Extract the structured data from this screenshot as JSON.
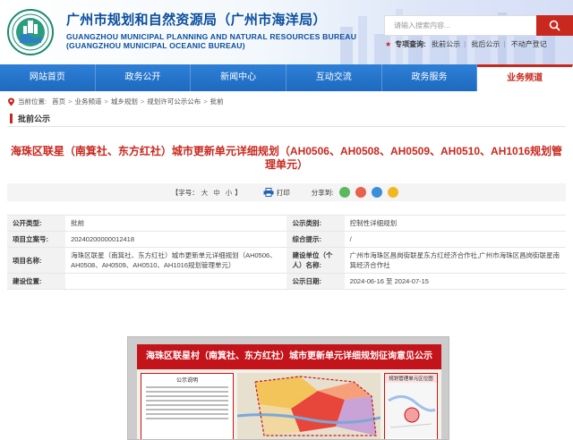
{
  "header": {
    "title_cn": "广州市规划和自然资源局（广州市海洋局）",
    "title_en_1": "GUANGZHOU MUNICIPAL PLANNING AND NATURAL RESOURCES BUREAU",
    "title_en_2": "(GUANGZHOU MUNICIPAL OCEANIC BUREAU)",
    "search_placeholder": "请输入搜索内容...",
    "hot_label": "专项查询:",
    "hot_links": [
      "批前公示",
      "批后公示",
      "不动产登记"
    ]
  },
  "nav": [
    "网站首页",
    "政务公开",
    "新闻中心",
    "互动交流",
    "政务服务",
    "业务频道"
  ],
  "nav_active_index": 5,
  "breadcrumb": {
    "label": "当前位置:",
    "items": [
      "首页",
      "业务频道",
      "城乡规划",
      "规划许可公示公布",
      "批前"
    ]
  },
  "section_title": "批前公示",
  "page_title": "海珠区联星（南箕社、东方红社）城市更新单元详细规划（AH0506、AH0508、AH0509、AH0510、AH1016规划管理单元）",
  "tools": {
    "font_label": "【字号：",
    "font_sizes": [
      "大",
      "中",
      "小"
    ],
    "font_close": "】",
    "print": "打印",
    "share_label": "分享到:"
  },
  "info": {
    "r1": {
      "k1": "公开类型:",
      "v1": "批前",
      "k2": "公示类别:",
      "v2": "控制性详细规划"
    },
    "r2": {
      "k1": "项目立案号:",
      "v1": "20240200000012418",
      "k2": "综合提示:",
      "v2": "/"
    },
    "r3": {
      "k1": "项目名称:",
      "v1": "海珠区联星（南箕社、东方红社）城市更新单元详细规划（AH0506、AH0508、AH0509、AH0510、AH1016规划管理单元）",
      "k2": "建设单位（个人）名称:",
      "v2": "广州市海珠区昌岗街联星东方红经济合作社,广州市海珠区昌岗街联星南箕经济合作社"
    },
    "r4": {
      "k1": "建设位置:",
      "v1": "",
      "k2": "公示日期:",
      "v2": "2024-06-16 至 2024-07-15"
    }
  },
  "poster": {
    "title": "海珠区联星村（南箕社、东方红社）城市更新单元详细规划征询意见公示",
    "notice_title": "公示说明",
    "side_title": "规划管理单元区位图"
  },
  "colors": {
    "brand_red": "#c8281e",
    "nav_blue": "#1d6ac0",
    "title_blue": "#0b4e9c"
  }
}
